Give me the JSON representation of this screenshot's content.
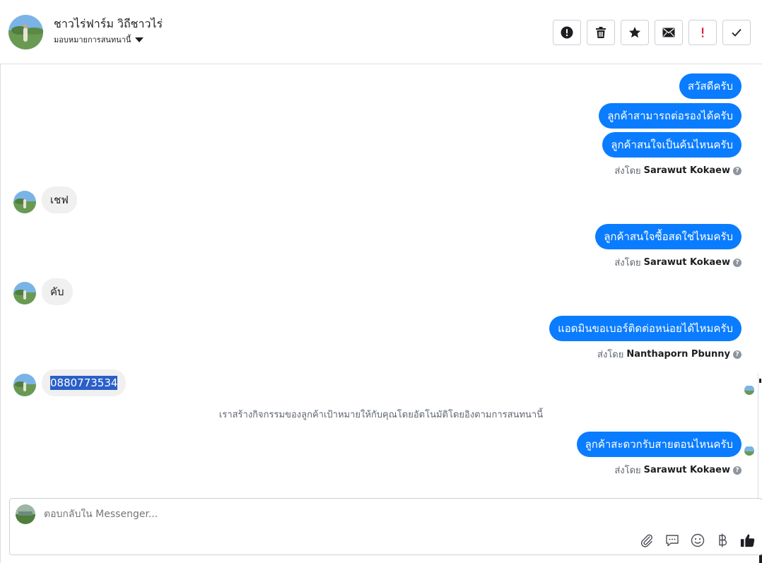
{
  "header": {
    "contact_name": "ชาวไร่ฟาร์ม วิถีชาวไร่",
    "assign_label": "มอบหมายการสนทนานี้",
    "toolbar": [
      {
        "name": "mark-spam-button",
        "icon": "exclamation-circle-icon"
      },
      {
        "name": "delete-button",
        "icon": "trash-icon"
      },
      {
        "name": "star-button",
        "icon": "star-icon"
      },
      {
        "name": "mark-unread-button",
        "icon": "envelope-icon"
      },
      {
        "name": "follow-up-button",
        "icon": "exclamation-red-icon"
      },
      {
        "name": "mark-done-button",
        "icon": "check-icon"
      }
    ]
  },
  "messages": {
    "out1": "สวัสดีครับ",
    "out2": "ลูกค้าสามารถต่อรองได้ครับ",
    "out3": "ลูกค้าสนใจเป็นค้นไหนครับ",
    "sent_prefix": "ส่งโดย",
    "sender1": "Sarawut Kokaew",
    "in1": "เชฟ",
    "out4": "ลูกค้าสนใจซื้อสดใช่ไหมครับ",
    "sender2": "Sarawut Kokaew",
    "in2": "คับ",
    "out5": "แอดมินขอเบอร์ติดต่อหน่อยได้ไหมครับ",
    "sender3": "Nanthaporn Pbunny",
    "in3": "0880773534",
    "system_note": "เราสร้างกิจกรรมของลูกค้าเป้าหมายให้กับคุณโดยอัตโนมัติโดยอิงตามการสนทนานี้",
    "out6": "ลูกค้าสะดวกรับสายตอนไหนครับ",
    "sender4": "Sarawut Kokaew"
  },
  "composer": {
    "placeholder": "ตอบกลับใน Messenger...",
    "tools": [
      "paperclip-icon",
      "saved-reply-icon",
      "emoji-icon",
      "baht-icon",
      "thumbs-up-icon"
    ]
  },
  "colors": {
    "accent": "#0a7cff",
    "incoming_bubble": "#f0f0f0",
    "highlight": "#2b5fc8",
    "follow_up": "#e41e3f"
  }
}
